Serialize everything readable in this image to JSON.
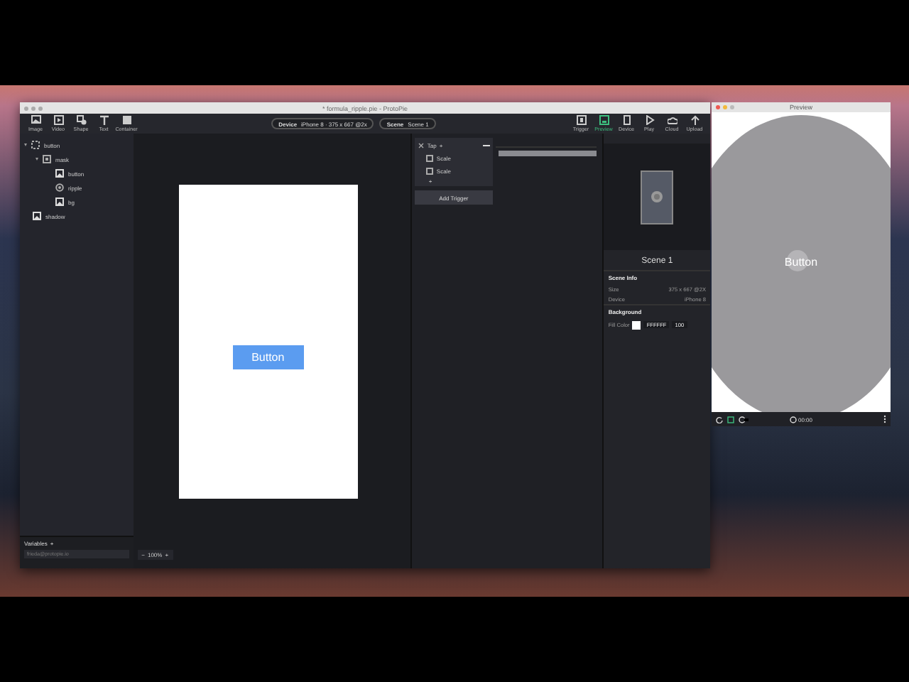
{
  "main_window": {
    "title": "* formula_ripple.pie - ProtoPie",
    "toolbar": {
      "left": [
        {
          "label": "Image",
          "kind": "image"
        },
        {
          "label": "Video",
          "kind": "video"
        },
        {
          "label": "Shape",
          "kind": "shape"
        },
        {
          "label": "Text",
          "kind": "text"
        },
        {
          "label": "Container",
          "kind": "container"
        }
      ],
      "device": {
        "label": "Device",
        "value": "iPhone 8 · 375 x 667 @2x"
      },
      "scene": {
        "label": "Scene",
        "value": "Scene 1"
      },
      "right": [
        {
          "label": "Trigger",
          "kind": "trigger",
          "selected": false
        },
        {
          "label": "Preview",
          "kind": "preview",
          "selected": true
        },
        {
          "label": "Device",
          "kind": "device",
          "selected": false
        },
        {
          "label": "Play",
          "kind": "play",
          "selected": false
        },
        {
          "label": "Cloud",
          "kind": "cloud",
          "selected": false
        },
        {
          "label": "Upload",
          "kind": "upload",
          "selected": false
        }
      ]
    },
    "layers": [
      {
        "name": "button",
        "kind": "group",
        "expanded": true,
        "children": [
          {
            "name": "mask",
            "kind": "mask",
            "expanded": true,
            "children": [
              {
                "name": "button",
                "kind": "image"
              },
              {
                "name": "ripple",
                "kind": "ripple"
              },
              {
                "name": "bg",
                "kind": "image"
              }
            ]
          }
        ]
      },
      {
        "name": "shadow",
        "kind": "image"
      }
    ],
    "variables": {
      "label": "Variables",
      "add": "+",
      "placeholder": "frieda@protopie.io"
    },
    "canvas": {
      "button_label": "Button",
      "zoom": {
        "minus": "−",
        "value": "100%",
        "plus": "+"
      }
    },
    "triggers": [
      {
        "name": "Tap",
        "add": "+",
        "children": [
          {
            "name": "Scale"
          },
          {
            "name": "Scale"
          }
        ],
        "add_response": "+"
      }
    ],
    "add_trigger": "Add Trigger",
    "inspector": {
      "title": "Scene 1",
      "scene_info": "Scene Info",
      "size_label": "Size",
      "size": "375 x 667 @2X",
      "device_label": "Device",
      "device": "iPhone 8",
      "background": "Background",
      "fill_label": "Fill Color",
      "fill_hex": "FFFFFF",
      "fill_opacity": "100"
    }
  },
  "preview_window": {
    "title": "Preview",
    "button_label": "Button",
    "time": "00:00"
  }
}
